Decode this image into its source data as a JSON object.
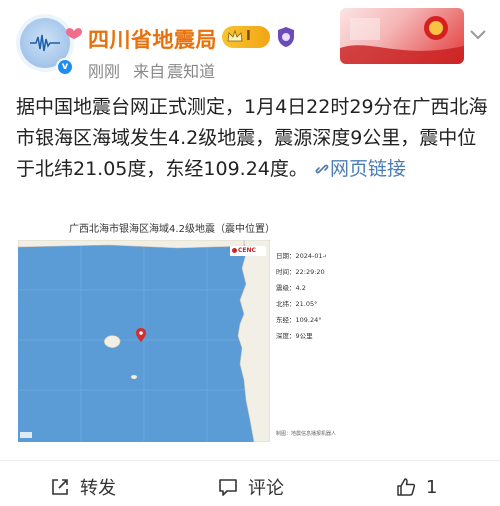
{
  "account": {
    "name": "四川省地震局",
    "level": "I",
    "time": "刚刚",
    "source_prefix": "来自",
    "source": "震知道",
    "verified_mark": "v"
  },
  "post": {
    "text": "据中国地震台网正式测定，1月4日22时29分在广西北海市银海区海域发生4.2级地震，震源深度9公里，震中位于北纬21.05度，东经109.24度。",
    "link_icon": "link-icon",
    "link_text": "网页链接"
  },
  "map": {
    "title": "广西北海市银海区海域4.2级地震（震中位置）",
    "logo": "CENC",
    "info": [
      "日期：2024-01-0",
      "时间：22:29:20",
      "震级：4.2",
      "北纬：21.05°",
      "东经：109.24°",
      "深度：9公里"
    ],
    "footnote": "制图：地震信息播报机器人",
    "colors": {
      "sea": "#5b9bd6",
      "land": "#f1efe6",
      "epicenter": "#d32f2f"
    }
  },
  "actions": {
    "repost": "转发",
    "comment": "评论",
    "like": "1"
  }
}
